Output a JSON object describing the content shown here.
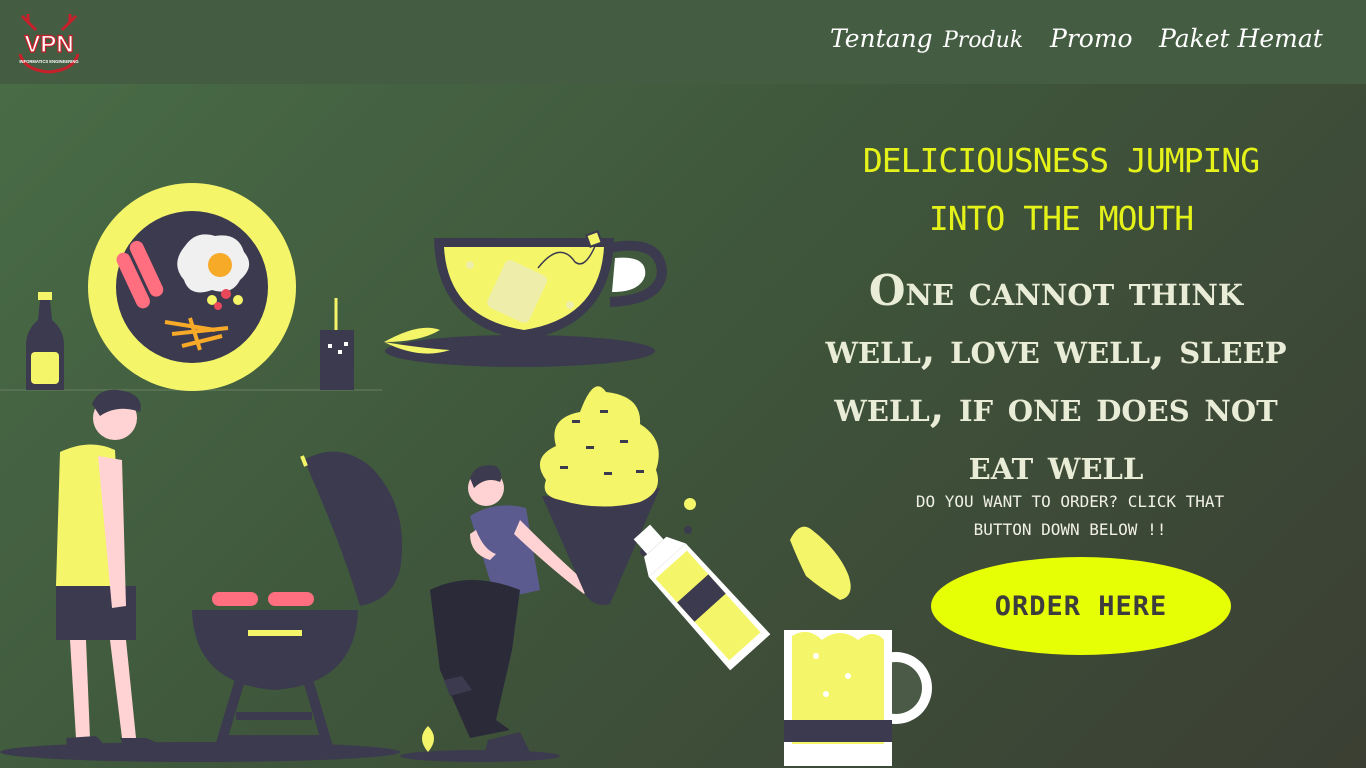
{
  "brand": {
    "logo_text": "VPN",
    "logo_subtext": "INFORMATICS ENGINEERING"
  },
  "nav": {
    "items": [
      {
        "label": "Tentang"
      },
      {
        "label": "Produk"
      },
      {
        "label": "Promo"
      },
      {
        "label": "Paket Hemat"
      }
    ]
  },
  "hero": {
    "headline": "DELICIOUSNESS JUMPING INTO THE MOUTH",
    "quote": "One cannot think well, love well, sleep well, if one does not eat well",
    "cta_text": "DO YOU WANT TO ORDER? CLICK THAT BUTTON DOWN BELOW !!",
    "order_button_label": "ORDER HERE"
  },
  "colors": {
    "background": "#4a6e47",
    "navbar": "#445c41",
    "accent_yellow": "#e6ff05",
    "illustration_yellow": "#f5f56a",
    "illustration_dark": "#3c3a4e",
    "headline_yellow": "#e4f21a"
  },
  "icons": [
    "vpn-logo",
    "food-plate-icon",
    "teacup-icon",
    "ice-cream-icon",
    "beer-mug-icon",
    "grill-icon"
  ]
}
